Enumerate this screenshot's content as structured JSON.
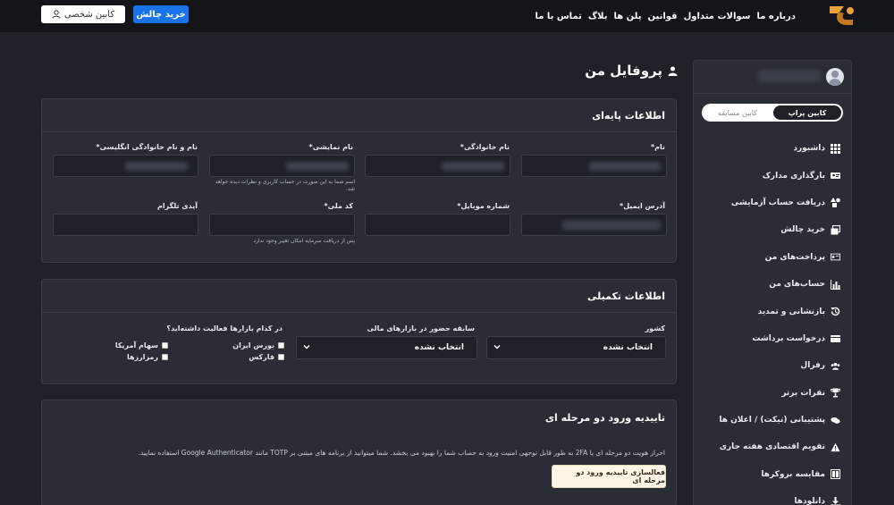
{
  "header": {
    "nav": [
      "درباره ما",
      "سوالات متداول",
      "قوانین",
      "پلن ها",
      "بلاگ",
      "تماس با ما"
    ],
    "buy_button": "خرید چالش",
    "cabin_button": "کابین شخصی"
  },
  "sidebar": {
    "toggle_active": "کابین پراپ",
    "toggle_inactive": "کابین مسابقه",
    "items": [
      {
        "label": "داشبورد",
        "icon": "grid-icon"
      },
      {
        "label": "بارگذاری مدارک",
        "icon": "id-card-icon"
      },
      {
        "label": "دریافت حساب آزمایشی",
        "icon": "shapes-icon"
      },
      {
        "label": "خرید چالش",
        "icon": "windows-icon"
      },
      {
        "label": "پرداخت‌های من",
        "icon": "receipt-icon"
      },
      {
        "label": "حساب‌های من",
        "icon": "chart-icon"
      },
      {
        "label": "بازنشانی و تمدید",
        "icon": "history-icon"
      },
      {
        "label": "درخواست برداشت",
        "icon": "wallet-icon"
      },
      {
        "label": "رفرال",
        "icon": "users-icon"
      },
      {
        "label": "نفرات برتر",
        "icon": "trophy-icon"
      },
      {
        "label": "پشتیبانی (تیکت) / اعلان ها",
        "icon": "chat-icon"
      },
      {
        "label": "تقویم اقتصادی هفته جاری",
        "icon": "warning-icon"
      },
      {
        "label": "مقایسه بروکرها",
        "icon": "compare-icon"
      },
      {
        "label": "دانلودها",
        "icon": "download-icon"
      }
    ]
  },
  "page": {
    "title": "پروفایل من"
  },
  "basic_info": {
    "title": "اطلاعات پایه‌ای",
    "first_name_label": "نام*",
    "last_name_label": "نام خانوادگی*",
    "display_name_label": "نام نمایشی*",
    "english_name_label": "نام و نام خانوادگی انگلیسی*",
    "display_name_hint": "اسم شما به این صورت در حساب کاربری و نظرات دیده خواهد شد.",
    "email_label": "آدرس ایمیل*",
    "mobile_label": "شماره موبایل*",
    "national_code_label": "کد ملی*",
    "national_code_hint": "پس از دریافت سرمایه امکان تغییر وجود ندارد",
    "telegram_label": "آیدی تلگرام"
  },
  "extra_info": {
    "title": "اطلاعات تکمیلی",
    "country_label": "کشور",
    "country_value": "انتخاب نشده",
    "experience_label": "سابقه حضور در بازارهای مالی",
    "experience_value": "انتخاب نشده",
    "markets_label": "در کدام بازارها فعالیت داشته‌اید؟",
    "markets": [
      "بورس ایران",
      "سهام آمریکا",
      "فارکس",
      "رمزارزها"
    ]
  },
  "two_factor": {
    "title": "تاییدیه ورود دو مرحله ای",
    "description": "احراز هویت دو مرحله ای یا 2FA به طور قابل توجهی امنیت ورود به حساب شما را بهبود می بخشد. شما میتوانید از برنامه های مبتنی بر TOTP مانند Google Authenticator استفاده نمایید.",
    "button": "فعالسازی تاییدیه ورود دو مرحله ای"
  }
}
